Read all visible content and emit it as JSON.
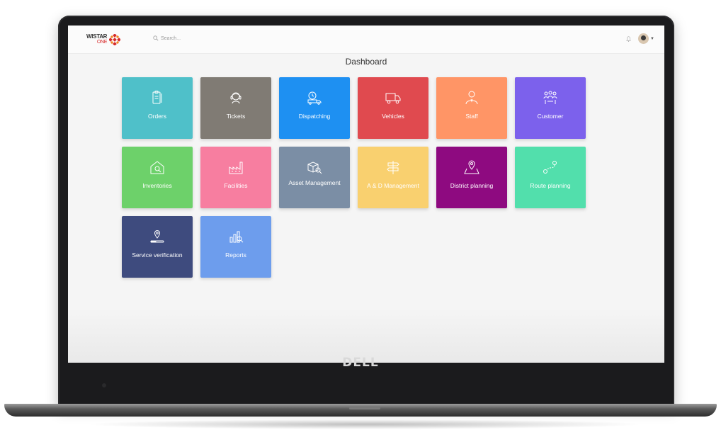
{
  "brand": {
    "logo_text": "WISTAR",
    "logo_subtext": "ONE",
    "bezel_brand": "DELL"
  },
  "search": {
    "placeholder": "Search..."
  },
  "page": {
    "title": "Dashboard"
  },
  "colors": {
    "orders": "#4fc0c9",
    "tickets": "#807b74",
    "dispatching": "#1e90f2",
    "vehicles": "#e04a4f",
    "staff": "#ff9566",
    "customer": "#7c61ec",
    "inventories": "#6dd16a",
    "facilities": "#f77ea0",
    "asset_management": "#7b8ea5",
    "ad_management": "#f9d06f",
    "district_planning": "#8e0a80",
    "route_planning": "#52dfac",
    "service_verification": "#3e4b7e",
    "reports": "#6d9ded"
  },
  "tiles": [
    {
      "label": "Orders",
      "icon": "clipboard-icon"
    },
    {
      "label": "Tickets",
      "icon": "headset-icon"
    },
    {
      "label": "Dispatching",
      "icon": "delivery-clock-icon"
    },
    {
      "label": "Vehicles",
      "icon": "truck-icon"
    },
    {
      "label": "Staff",
      "icon": "person-icon"
    },
    {
      "label": "Customer",
      "icon": "group-icon"
    },
    {
      "label": "Inventories",
      "icon": "warehouse-icon"
    },
    {
      "label": "Facilities",
      "icon": "factory-icon"
    },
    {
      "label": "Asset Management",
      "icon": "box-search-icon"
    },
    {
      "label": "A & D Management",
      "icon": "signpost-icon"
    },
    {
      "label": "District planning",
      "icon": "map-pin-icon"
    },
    {
      "label": "Route planning",
      "icon": "route-icon"
    },
    {
      "label": "Service verification",
      "icon": "location-check-icon"
    },
    {
      "label": "Reports",
      "icon": "reports-icon"
    }
  ]
}
